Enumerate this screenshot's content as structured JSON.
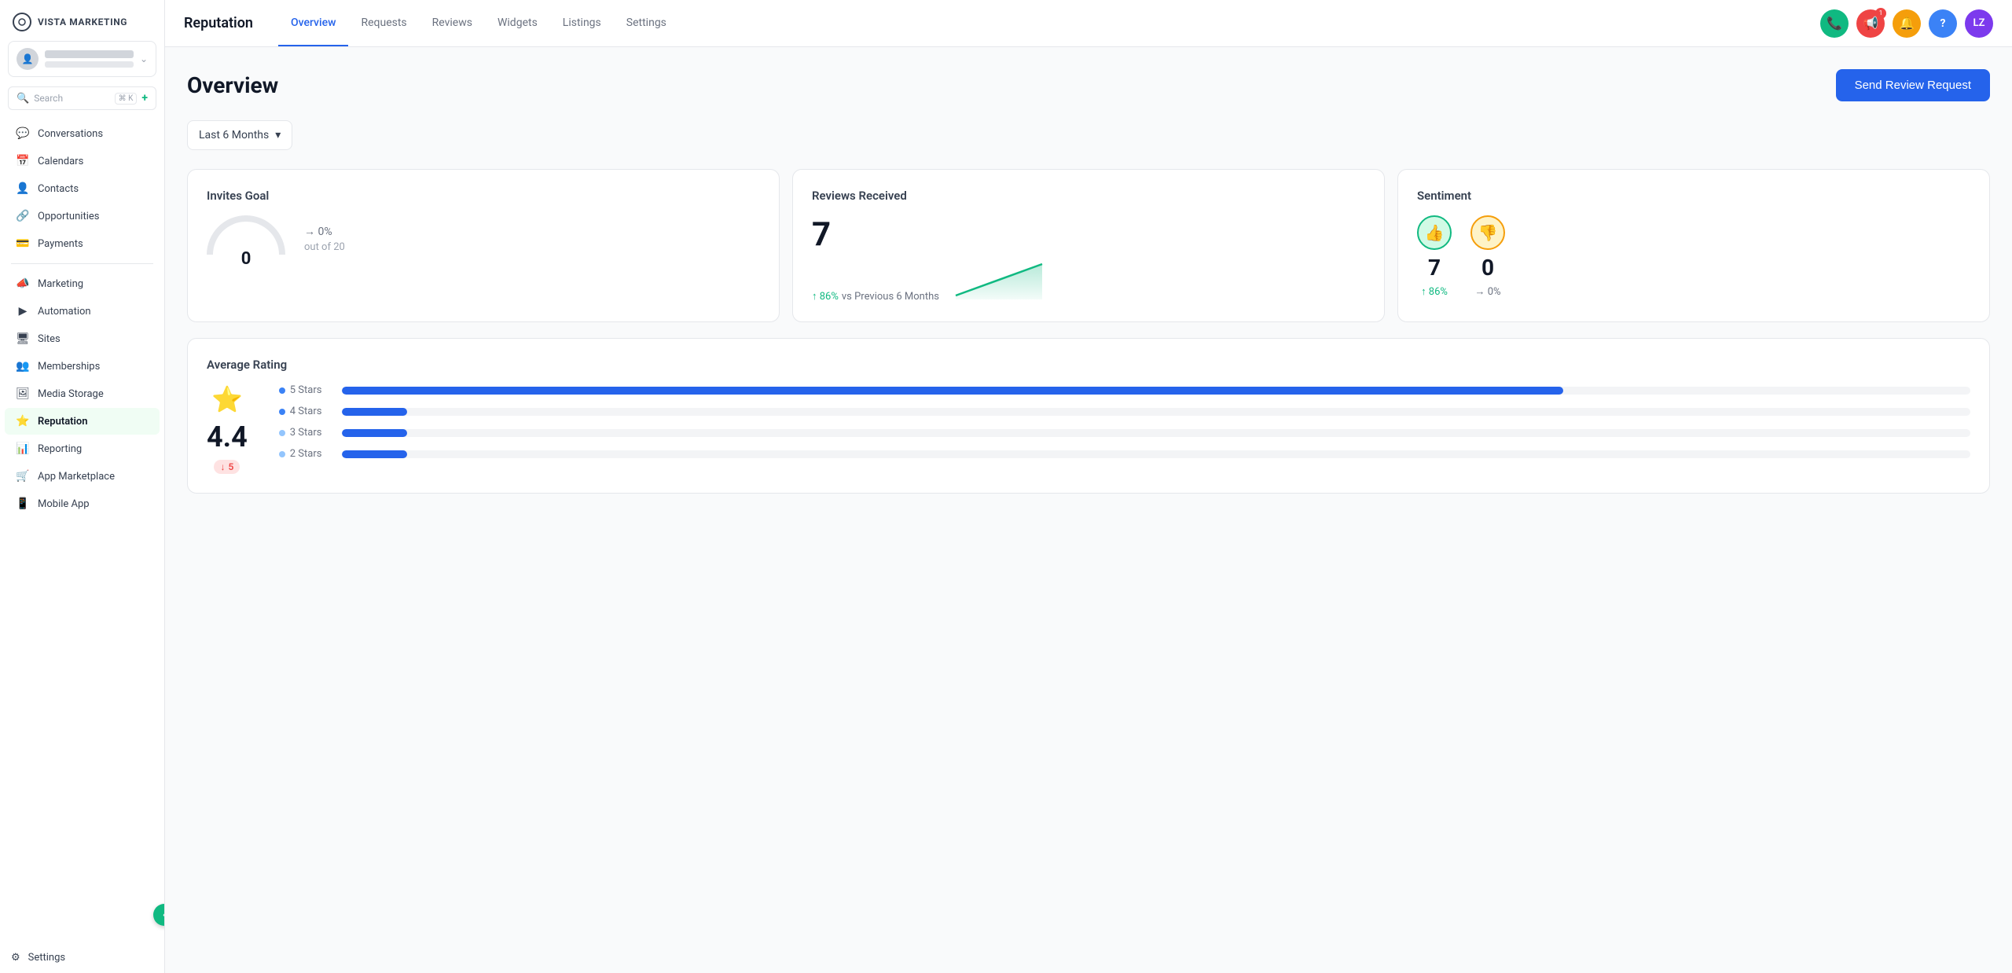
{
  "sidebar": {
    "logo_text": "VISTA MARKETING",
    "search_placeholder": "Search",
    "search_shortcut": "⌘ K",
    "nav_items": [
      {
        "id": "conversations",
        "label": "Conversations",
        "icon": "💬"
      },
      {
        "id": "calendars",
        "label": "Calendars",
        "icon": "📅"
      },
      {
        "id": "contacts",
        "label": "Contacts",
        "icon": "👤"
      },
      {
        "id": "opportunities",
        "label": "Opportunities",
        "icon": "🔗"
      },
      {
        "id": "payments",
        "label": "Payments",
        "icon": "💳"
      }
    ],
    "nav_items2": [
      {
        "id": "marketing",
        "label": "Marketing",
        "icon": "📣"
      },
      {
        "id": "automation",
        "label": "Automation",
        "icon": "▶"
      },
      {
        "id": "sites",
        "label": "Sites",
        "icon": "🖥"
      },
      {
        "id": "memberships",
        "label": "Memberships",
        "icon": "👥"
      },
      {
        "id": "media-storage",
        "label": "Media Storage",
        "icon": "🖼"
      },
      {
        "id": "reputation",
        "label": "Reputation",
        "icon": "⭐",
        "active": true
      },
      {
        "id": "reporting",
        "label": "Reporting",
        "icon": "📊"
      },
      {
        "id": "app-marketplace",
        "label": "App Marketplace",
        "icon": "🛒"
      },
      {
        "id": "mobile-app",
        "label": "Mobile App",
        "icon": "📱"
      }
    ],
    "settings_label": "Settings",
    "collapse_icon": "‹"
  },
  "topbar": {
    "title": "Reputation",
    "tabs": [
      {
        "id": "overview",
        "label": "Overview",
        "active": true
      },
      {
        "id": "requests",
        "label": "Requests",
        "active": false
      },
      {
        "id": "reviews",
        "label": "Reviews",
        "active": false
      },
      {
        "id": "widgets",
        "label": "Widgets",
        "active": false
      },
      {
        "id": "listings",
        "label": "Listings",
        "active": false
      },
      {
        "id": "settings",
        "label": "Settings",
        "active": false
      }
    ],
    "icon_buttons": [
      {
        "id": "phone",
        "icon": "📞",
        "style": "green"
      },
      {
        "id": "megaphone",
        "icon": "📢",
        "style": "red",
        "badge": "1"
      },
      {
        "id": "bell",
        "icon": "🔔",
        "style": "orange"
      },
      {
        "id": "help",
        "icon": "?",
        "style": "blue"
      }
    ],
    "user_avatar": "LZ"
  },
  "content": {
    "page_title": "Overview",
    "send_review_btn": "Send Review Request",
    "filter": {
      "label": "Last 6 Months",
      "icon": "▾"
    },
    "invites_goal": {
      "title": "Invites Goal",
      "value": "0",
      "percentage": "→ 0%",
      "out_of": "out of 20"
    },
    "reviews_received": {
      "title": "Reviews Received",
      "count": "7",
      "change_pct": "86%",
      "change_label": "vs Previous 6 Months"
    },
    "sentiment": {
      "title": "Sentiment",
      "positive_count": "7",
      "positive_pct": "↑ 86%",
      "negative_count": "0",
      "negative_pct": "→ 0%"
    },
    "average_rating": {
      "title": "Average Rating",
      "rating": "4.4",
      "change": "↓ 5",
      "bars": [
        {
          "label": "5 Stars",
          "width": 75,
          "faded": false
        },
        {
          "label": "4 Stars",
          "width": 4,
          "faded": false
        },
        {
          "label": "3 Stars",
          "width": 4,
          "faded": true
        },
        {
          "label": "2 Stars",
          "width": 4,
          "faded": true
        }
      ]
    }
  }
}
